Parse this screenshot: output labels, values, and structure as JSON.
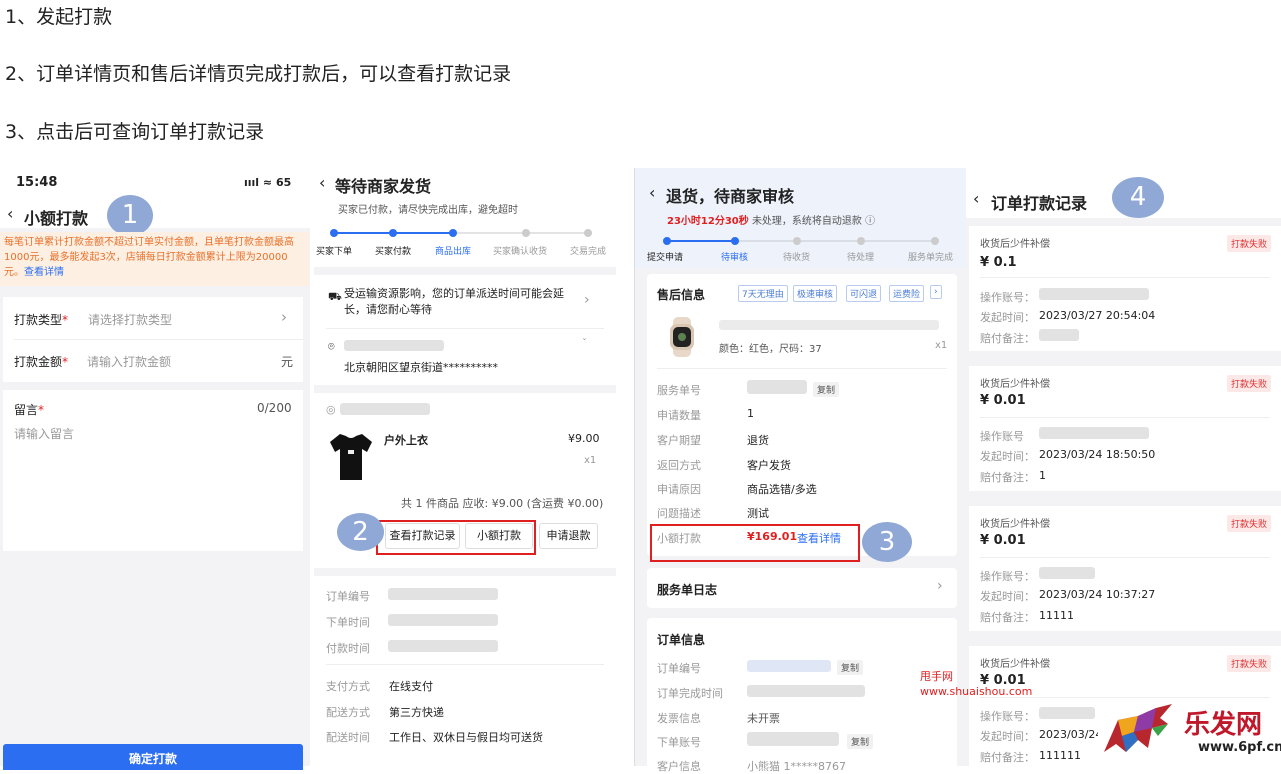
{
  "steps": [
    "1、发起打款",
    "2、订单详情页和售后详情页完成打款后，可以查看打款记录",
    "3、点击后可查询订单打款记录"
  ],
  "markers": [
    "1",
    "2",
    "3",
    "4"
  ],
  "panel1": {
    "time": "15:48",
    "status_icons": "ıııl ≈ 65",
    "title": "小额打款",
    "notice": "每笔订单累计打款金额不超过订单实付金额，且单笔打款金额最高1000元，最多能发起3次，店铺每日打款金额累计上限为20000元。",
    "notice_link": "查看详情",
    "type_label": "打款类型",
    "type_placeholder": "请选择打款类型",
    "amount_label": "打款金额",
    "amount_placeholder": "请输入打款金额",
    "amount_unit": "元",
    "msg_label": "留言",
    "msg_count": "0/200",
    "msg_placeholder": "请输入留言",
    "confirm": "确定打款",
    "required_mark": "*"
  },
  "panel2": {
    "title": "等待商家发货",
    "subtitle": "买家已付款，请尽快完成出库，避免超时",
    "progress": [
      "买家下单",
      "买家付款",
      "商品出库",
      "买家确认收货",
      "交易完成"
    ],
    "notice": "受运输资源影响，您的订单派送时间可能会延长，请您耐心等待",
    "address": "北京朝阳区望京街道**********",
    "product_name": "户外上衣",
    "product_price": "¥9.00",
    "product_qty": "x1",
    "summary": "共 1 件商品  应收: ¥9.00 (含运费 ¥0.00)",
    "btn_view": "查看打款记录",
    "btn_pay": "小额打款",
    "btn_refund": "申请退款",
    "rows": [
      {
        "label": "订单编号",
        "value": ""
      },
      {
        "label": "下单时间",
        "value": ""
      },
      {
        "label": "付款时间",
        "value": ""
      },
      {
        "label": "支付方式",
        "value": "在线支付"
      },
      {
        "label": "配送方式",
        "value": "第三方快递"
      },
      {
        "label": "配送时间",
        "value": "工作日、双休日与假日均可送货"
      }
    ]
  },
  "panel3": {
    "title": "退货，待商家审核",
    "countdown": "23小时12分30秒",
    "countdown_suffix": "未处理，系统将自动退款 ⓘ",
    "progress": [
      "提交申请",
      "待审核",
      "待收货",
      "待处理",
      "服务单完成"
    ],
    "section_title": "售后信息",
    "tags": [
      "7天无理由",
      "极速审核",
      "可闪退",
      "运费险",
      "›"
    ],
    "product_spec": "颜色：红色，尺码：37",
    "product_qty": "x1",
    "rows": [
      {
        "label": "服务单号",
        "value": ""
      },
      {
        "label": "申请数量",
        "value": "1"
      },
      {
        "label": "客户期望",
        "value": "退货"
      },
      {
        "label": "返回方式",
        "value": "客户发货"
      },
      {
        "label": "申请原因",
        "value": "商品选错/多选"
      },
      {
        "label": "问题描述",
        "value": "测试"
      }
    ],
    "copy": "复制",
    "micro_label": "小额打款",
    "micro_amount": "¥169.01",
    "micro_link": "查看详情",
    "log_title": "服务单日志",
    "order_title": "订单信息",
    "order_rows": [
      {
        "label": "订单编号",
        "value": ""
      },
      {
        "label": "订单完成时间",
        "value": ""
      },
      {
        "label": "发票信息",
        "value": "未开票"
      },
      {
        "label": "下单账号",
        "value": ""
      },
      {
        "label": "客户信息",
        "value": "小熊猫  1*****8767"
      }
    ]
  },
  "panel4": {
    "title": "订单打款记录",
    "records": [
      {
        "type": "收货后少件补偿",
        "amount": "¥ 0.1",
        "status": "打款失败",
        "account_label": "操作账号：",
        "time_label": "发起时间：",
        "time": "2023/03/27 20:54:04",
        "note_label": "赔付备注：",
        "note": ""
      },
      {
        "type": "收货后少件补偿",
        "amount": "¥ 0.01",
        "status": "打款失败",
        "account_label": "操作账号",
        "time_label": "发起时间：",
        "time": "2023/03/24 18:50:50",
        "note_label": "赔付备注：",
        "note": "1"
      },
      {
        "type": "收货后少件补偿",
        "amount": "¥ 0.01",
        "status": "打款失败",
        "account_label": "操作账号：",
        "time_label": "发起时间：",
        "time": "2023/03/24 10:37:27",
        "note_label": "赔付备注：",
        "note": "11111"
      },
      {
        "type": "收货后少件补偿",
        "amount": "¥ 0.01",
        "status": "打款失败",
        "account_label": "操作账号：",
        "time_label": "发起时间：",
        "time": "2023/03/24",
        "note_label": "赔付备注：",
        "note": "111111"
      }
    ]
  },
  "watermarks": {
    "site_name": "甩手网",
    "site_url": "www.shuaishou.com",
    "logo_text": "乐发网",
    "logo_url": "www.6pf.cn"
  },
  "colors": {
    "accent": "#2b6ef2",
    "price_red": "#e02020",
    "notice_bg": "#fdf0e2",
    "notice_text": "#e8702a"
  }
}
